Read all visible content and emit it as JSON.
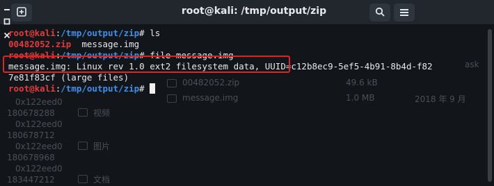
{
  "window": {
    "title": "root@kali: /tmp/output/zip"
  },
  "icons": {
    "newtab": "new-tab-icon",
    "search": "search-icon",
    "menu": "hamburger-menu-icon",
    "minimize": "minimize-icon",
    "maximize": "maximize-icon",
    "close": "close-icon"
  },
  "colors": {
    "prompt_user": "#e33b3b",
    "prompt_path": "#3e8fe8",
    "highlight_box": "#e02424",
    "background": "#12161b"
  },
  "terminal": {
    "lines": [
      {
        "user": "root@kali",
        "sep": ":",
        "path": "/tmp/output/zip",
        "sym": "#",
        "cmd": " ls"
      },
      {
        "output_red": "00482052.zip",
        "output_rest": "  message.img"
      },
      {
        "user": "root@kali",
        "sep": ":",
        "path": "/tmp/output/zip",
        "sym": "#",
        "cmd": " file message.img"
      },
      {
        "output": "message.img: Linux rev 1.0 ext2 filesystem data, UUID=c12b8ec9-5ef5-4b91-8b4d-f82"
      },
      {
        "output": "7e81f83cf (large files)"
      },
      {
        "user": "root@kali",
        "sep": ":",
        "path": "/tmp/output/zip",
        "sym": "#",
        "cmd": " "
      }
    ]
  },
  "background_ghost": {
    "hex_rows": [
      "0x122eed0",
      "180678288",
      "0x122eed0",
      "180678712",
      "0x122eed0",
      "180678968",
      "0x122eed0",
      "183447212"
    ],
    "sidebar": [
      "视频",
      "图片",
      "文档"
    ],
    "files": [
      {
        "name": "00482052.zip",
        "size": "49.6 kB",
        "date": ""
      },
      {
        "name": "message.img",
        "size": "1.0 MB",
        "date": "2018 年 9 月"
      }
    ],
    "tab_hint": "ask"
  }
}
